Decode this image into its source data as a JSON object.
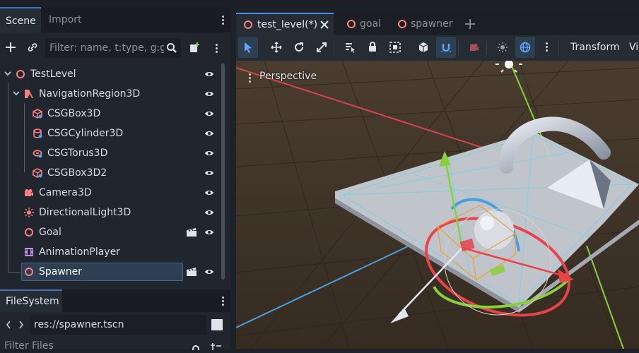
{
  "scene_dock": {
    "tabs": [
      {
        "label": "Scene",
        "active": true
      },
      {
        "label": "Import",
        "active": false
      }
    ],
    "filter_placeholder": "Filter: name, t:type, g:gr",
    "tree": [
      {
        "label": "TestLevel",
        "icon": "node3d-icon"
      },
      {
        "label": "NavigationRegion3D",
        "icon": "navigation-region-icon"
      },
      {
        "label": "CSGBox3D",
        "icon": "csg-box-icon"
      },
      {
        "label": "CSGCylinder3D",
        "icon": "csg-cylinder-icon"
      },
      {
        "label": "CSGTorus3D",
        "icon": "csg-torus-icon"
      },
      {
        "label": "CSGBox3D2",
        "icon": "csg-box-icon"
      },
      {
        "label": "Camera3D",
        "icon": "camera-icon"
      },
      {
        "label": "DirectionalLight3D",
        "icon": "light-icon"
      },
      {
        "label": "Goal",
        "icon": "node3d-icon"
      },
      {
        "label": "AnimationPlayer",
        "icon": "animation-icon"
      },
      {
        "label": "Spawner",
        "icon": "node3d-icon",
        "selected": true
      }
    ]
  },
  "filesystem": {
    "tab": "FileSystem",
    "path": "res://spawner.tscn",
    "filter_placeholder": "Filter Files"
  },
  "editor": {
    "tabs": [
      {
        "label": "test_level(*)",
        "active": true
      },
      {
        "label": "goal",
        "active": false
      },
      {
        "label": "spawner",
        "active": false
      }
    ],
    "transform_label": "Transform",
    "view_label": "Vi",
    "viewport_label": "Perspective"
  },
  "colors": {
    "accent": "#4b8ee8",
    "node_red": "#fc7f7f",
    "x_axis": "#e8434b",
    "y_axis": "#87d13a",
    "z_axis": "#4a9ee0"
  }
}
